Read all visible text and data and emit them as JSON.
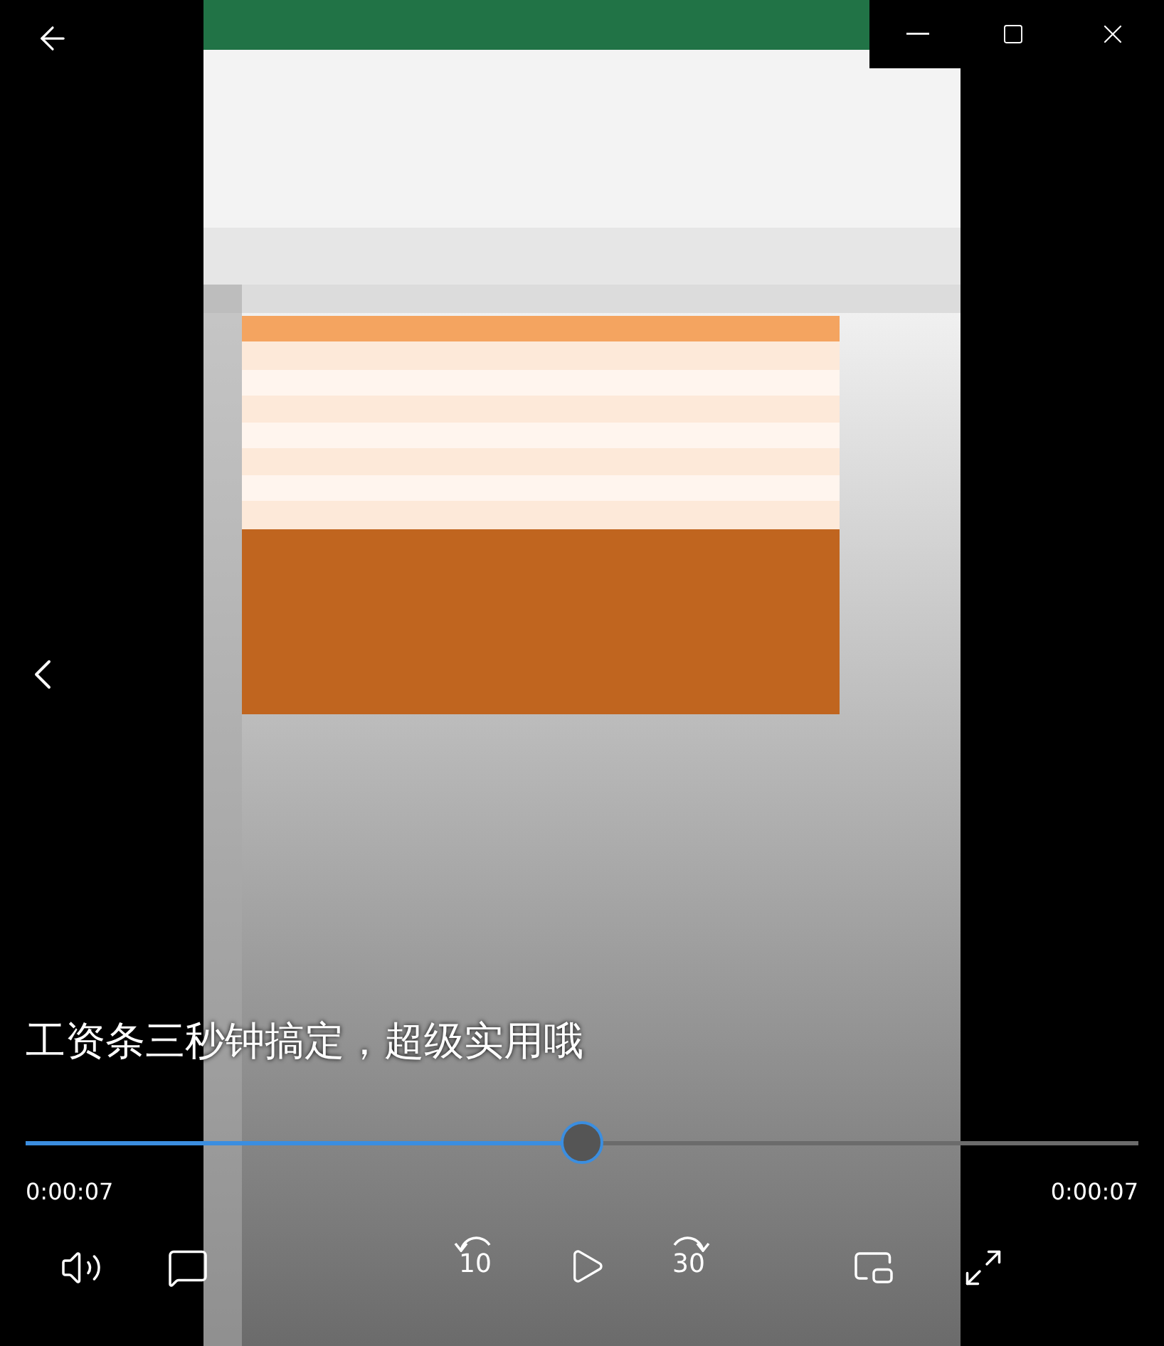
{
  "subtitle": "工资条三秒钟搞定，超级实用哦",
  "progress": {
    "level": 0.5
  },
  "elapsed": "0:00:07",
  "duration": "0:00:07",
  "skip_back": {
    "label": "10"
  },
  "skip_forward": {
    "label": "30"
  }
}
